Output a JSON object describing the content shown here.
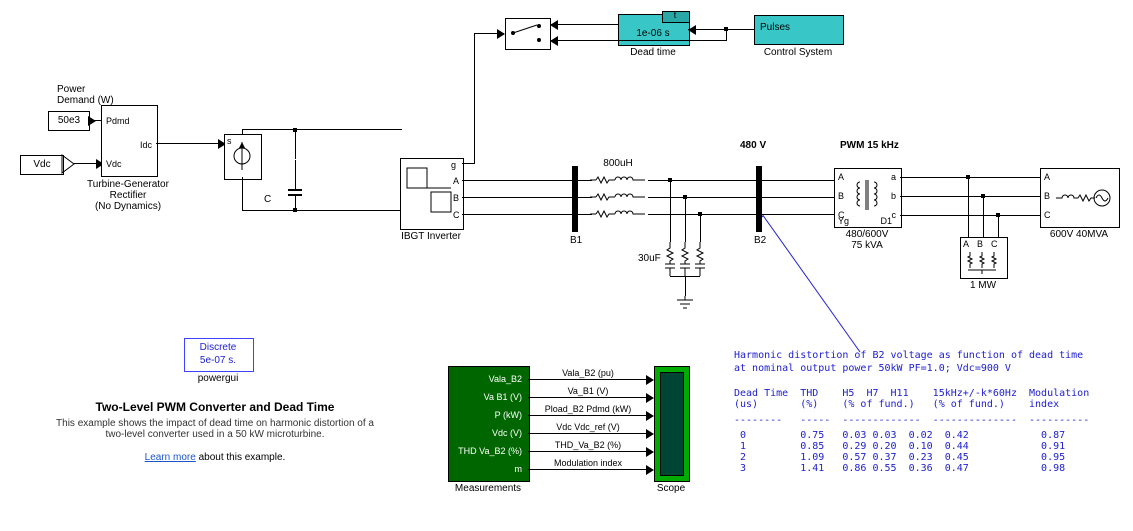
{
  "inputs": {
    "power_demand_label": "Power\nDemand (W)",
    "power_demand_value": "50e3",
    "vdc_label": "Vdc"
  },
  "blocks": {
    "turbine": {
      "pdmd": "Pdmd",
      "idc": "Idc",
      "vdc": "Vdc",
      "name": "Turbine-Generator\nRectifier\n(No Dynamics)"
    },
    "cap_c": "C",
    "ibgt": "IBGT Inverter",
    "ibgt_ports": {
      "g": "g",
      "a": "A",
      "b": "B",
      "c": "C"
    },
    "bus1": "B1",
    "bus2": "B2",
    "inductor": "800uH",
    "cap30": "30uF",
    "volt480": "480 V",
    "pwm": "PWM 15 kHz",
    "xfmr": {
      "a": "A",
      "b": "B",
      "c": "C",
      "a2": "a",
      "b2": "b",
      "c2": "c",
      "yg": "Yg",
      "d1": "D1",
      "name": "480/600V\n75 kVA"
    },
    "load_right": {
      "a": "A",
      "b": "B",
      "c": "C",
      "name": "600V 40MVA"
    },
    "load_1mw": {
      "name": "1 MW",
      "a": "A",
      "b": "B",
      "c": "C"
    },
    "dead_time": {
      "t": "t",
      "val": "1e-06 s",
      "name": "Dead time"
    },
    "control": {
      "label": "Pulses",
      "name": "Control System"
    }
  },
  "powergui": {
    "mode": "Discrete",
    "step": "5e-07 s.",
    "name": "powergui"
  },
  "title": "Two-Level PWM Converter and Dead Time",
  "desc": "This example shows the impact of dead time on harmonic distortion of a\ntwo-level converter used in a 50 kW microturbine.",
  "learn": "Learn more",
  "learn_after": " about this example.",
  "measurements": {
    "name": "Measurements",
    "ports": [
      "Vala_B2",
      "Va B1 (V)",
      "P (kW)",
      "Vdc (V)",
      "THD Va_B2 (%)",
      "m"
    ],
    "signals": [
      "Vala_B2 (pu)",
      "Va_B1 (V)",
      "Pload_B2 Pdmd (kW)",
      "Vdc Vdc_ref (V)",
      "THD_Va_B2 (%)",
      "Modulation index"
    ]
  },
  "scope_name": "Scope",
  "table": {
    "header1": "Harmonic distortion of B2 voltage as function of dead time",
    "header2": "at nominal output power 50kW PF=1.0; Vdc=900 V",
    "cols": [
      "Dead Time\n(us)",
      "THD\n(%)",
      "H5  H7  H11\n(% of fund.)",
      "15kHz+/-k*60Hz\n(% of fund.)",
      "Modulation\nindex"
    ],
    "sep": "--------   -----  -------------  --------------  ----------",
    "rows": [
      [
        " 0",
        "0.75",
        "0.03 0.03  0.02",
        "0.42",
        "0.87"
      ],
      [
        " 1",
        "0.85",
        "0.29 0.20  0.10",
        "0.44",
        "0.91"
      ],
      [
        " 2",
        "1.09",
        "0.57 0.37  0.23",
        "0.45",
        "0.95"
      ],
      [
        " 3",
        "1.41",
        "0.86 0.55  0.36",
        "0.47",
        "0.98"
      ]
    ]
  },
  "chart_data": {
    "type": "table",
    "title": "Harmonic distortion of B2 voltage as function of dead time at nominal output power 50kW PF=1.0; Vdc=900 V",
    "columns": [
      "Dead Time (us)",
      "THD (%)",
      "H5 (% of fund.)",
      "H7 (% of fund.)",
      "H11 (% of fund.)",
      "15kHz±k*60Hz (% of fund.)",
      "Modulation index"
    ],
    "rows": [
      [
        0,
        0.75,
        0.03,
        0.03,
        0.02,
        0.42,
        0.87
      ],
      [
        1,
        0.85,
        0.29,
        0.2,
        0.1,
        0.44,
        0.91
      ],
      [
        2,
        1.09,
        0.57,
        0.37,
        0.23,
        0.45,
        0.95
      ],
      [
        3,
        1.41,
        0.86,
        0.55,
        0.36,
        0.47,
        0.98
      ]
    ]
  }
}
